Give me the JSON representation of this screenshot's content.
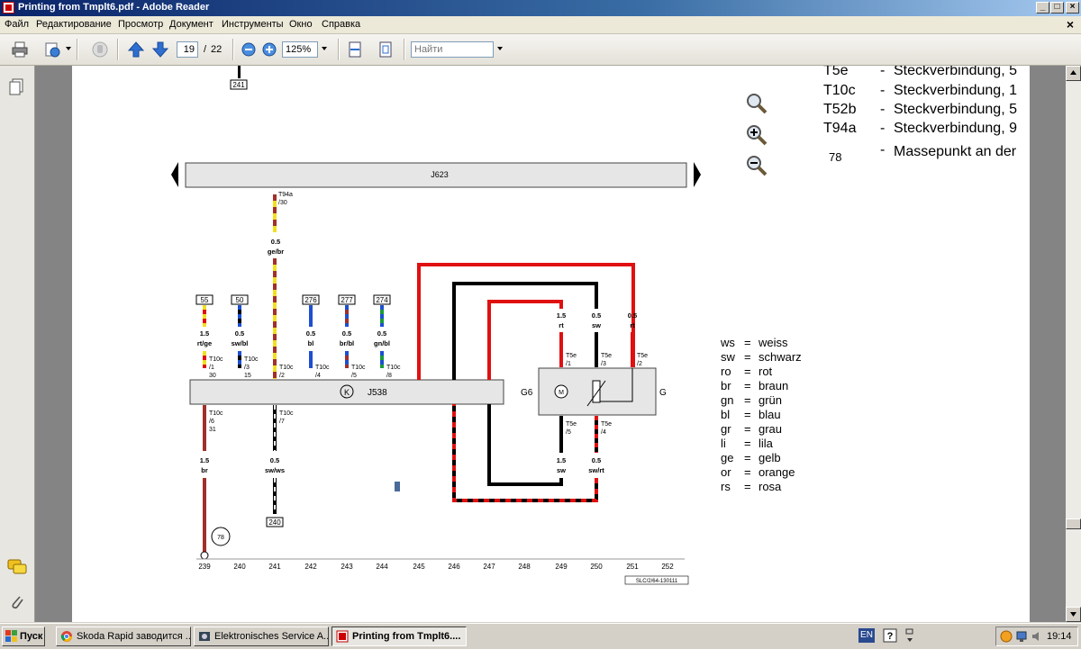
{
  "window": {
    "title": "Printing from Tmplt6.pdf - Adobe Reader",
    "buttons": {
      "minimize": "_",
      "maximize": "□",
      "close": "×"
    }
  },
  "menu": {
    "items": [
      "Файл",
      "Редактирование",
      "Просмотр",
      "Документ",
      "Инструменты",
      "Окно",
      "Справка"
    ],
    "close": "×"
  },
  "toolbar": {
    "page_current": "19",
    "page_separator": "/",
    "page_total": "22",
    "zoom": "125%",
    "search_placeholder": "Найти"
  },
  "diagram": {
    "top_ref": "241",
    "bus_label": "J623",
    "bus_sub": "623",
    "top_connector": {
      "name": "T94a",
      "pin": "/30",
      "size": "0.5",
      "color": "ge/br"
    },
    "left_pins": [
      {
        "ref": "55",
        "size": "1.5",
        "color": "rt/ge",
        "conn": "T10c",
        "pin": "/1",
        "pin2": "30"
      },
      {
        "ref": "50",
        "size": "0.5",
        "color": "sw/bl",
        "conn": "T10c",
        "pin": "/3",
        "pin2": "15"
      },
      {
        "ref": "276",
        "size": "0.5",
        "color": "bl",
        "conn": "T10c",
        "pin": "/4",
        "pin2": ""
      },
      {
        "ref": "277",
        "size": "0.5",
        "color": "br/bl",
        "conn": "T10c",
        "pin": "/5",
        "pin2": ""
      },
      {
        "ref": "274",
        "size": "0.5",
        "color": "gn/bl",
        "conn": "T10c",
        "pin": "/8",
        "pin2": ""
      }
    ],
    "mid_conn": {
      "conn": "T10c",
      "pin": "/2"
    },
    "bottom_left": {
      "conn": "T10c",
      "pin": "/6",
      "pin2": "31",
      "size": "1.5",
      "color": "br",
      "ground": "78"
    },
    "bottom_mid": {
      "conn": "T10c",
      "pin": "/7",
      "size": "0.5",
      "color": "sw/ws",
      "ref": "240"
    },
    "module": {
      "label": "J538",
      "symbol": "K"
    },
    "sensor": {
      "left_label": "G6",
      "right_label": "G",
      "motor": "M"
    },
    "sensor_top": [
      {
        "size": "1.5",
        "color": "rt",
        "conn": "T5e",
        "pin": "/1"
      },
      {
        "size": "0.5",
        "color": "sw",
        "conn": "T5e",
        "pin": "/3"
      },
      {
        "size": "0.5",
        "color": "rt",
        "conn": "T5e",
        "pin": "/2"
      }
    ],
    "sensor_bottom": [
      {
        "size": "1.5",
        "color": "sw",
        "conn": "T5e",
        "pin": "/5"
      },
      {
        "size": "0.5",
        "color": "sw/rt",
        "conn": "T5e",
        "pin": "/4"
      }
    ],
    "columns": [
      "239",
      "240",
      "241",
      "242",
      "243",
      "244",
      "245",
      "246",
      "247",
      "248",
      "249",
      "250",
      "251",
      "252"
    ],
    "footer_code": "SLC/2/64-130111"
  },
  "legend_top": [
    {
      "code": "T5e",
      "text": "Steckverbindung, 5"
    },
    {
      "code": "T10c",
      "text": "Steckverbindung, 1"
    },
    {
      "code": "T52b",
      "text": "Steckverbindung, 5"
    },
    {
      "code": "T94a",
      "text": "Steckverbindung, 9"
    },
    {
      "code": "78",
      "text": "Massepunkt an der"
    }
  ],
  "legend_colors": [
    {
      "code": "ws",
      "name": "weiss"
    },
    {
      "code": "sw",
      "name": "schwarz"
    },
    {
      "code": "ro",
      "name": "rot"
    },
    {
      "code": "br",
      "name": "braun"
    },
    {
      "code": "gn",
      "name": "grün"
    },
    {
      "code": "bl",
      "name": "blau"
    },
    {
      "code": "gr",
      "name": "grau"
    },
    {
      "code": "li",
      "name": "lila"
    },
    {
      "code": "ge",
      "name": "gelb"
    },
    {
      "code": "or",
      "name": "orange"
    },
    {
      "code": "rs",
      "name": "rosa"
    }
  ],
  "taskbar": {
    "start": "Пуск",
    "tasks": [
      "Skoda Rapid заводится ...",
      "Elektronisches Service A...",
      "Printing from Tmplt6...."
    ],
    "lang": "EN",
    "clock": "19:14"
  },
  "colors": {
    "title_bar": "#0a246a",
    "wire_red": "#e01010",
    "wire_brown": "#a0302a",
    "wire_yellow": "#f0e020",
    "wire_blue": "#1d4fd0",
    "wire_green": "#1a9a3a"
  }
}
